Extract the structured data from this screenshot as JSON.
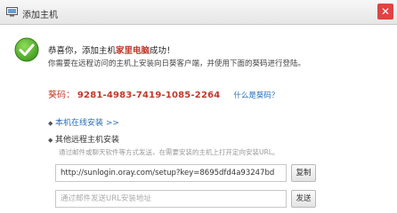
{
  "window": {
    "title": "添加主机",
    "close_symbol": "✕"
  },
  "message": {
    "headline_prefix": "恭喜你，添加主机",
    "host_name": "家里电脑",
    "headline_suffix": "成功！",
    "subline": "你需要在远程访问的主机上安装向日葵客户端，并使用下面的葵码进行登陆。"
  },
  "code": {
    "label": "葵码：",
    "value": "9281-4983-7419-1085-2264",
    "help_link": "什么是葵码？"
  },
  "options": {
    "local_install": "本机在线安装 >>",
    "remote_install": "其他远程主机安装"
  },
  "remote": {
    "hint": "通过邮件或聊天软件等方式发送，在需要安装的主机上打开定向安装URL。",
    "url_value": "http://sunlogin.oray.com/setup?key=8695dfd4a93247bd",
    "copy_label": "复制",
    "email_placeholder": "通过邮件发送URL安装地址",
    "send_label": "发送"
  },
  "icons": {
    "title": "monitor-icon",
    "success": "check-circle-icon",
    "close": "close-icon"
  },
  "colors": {
    "accent_red": "#c0392b",
    "link_blue": "#2a6db5",
    "success_green": "#4caf2a",
    "close_red": "#e04343"
  }
}
